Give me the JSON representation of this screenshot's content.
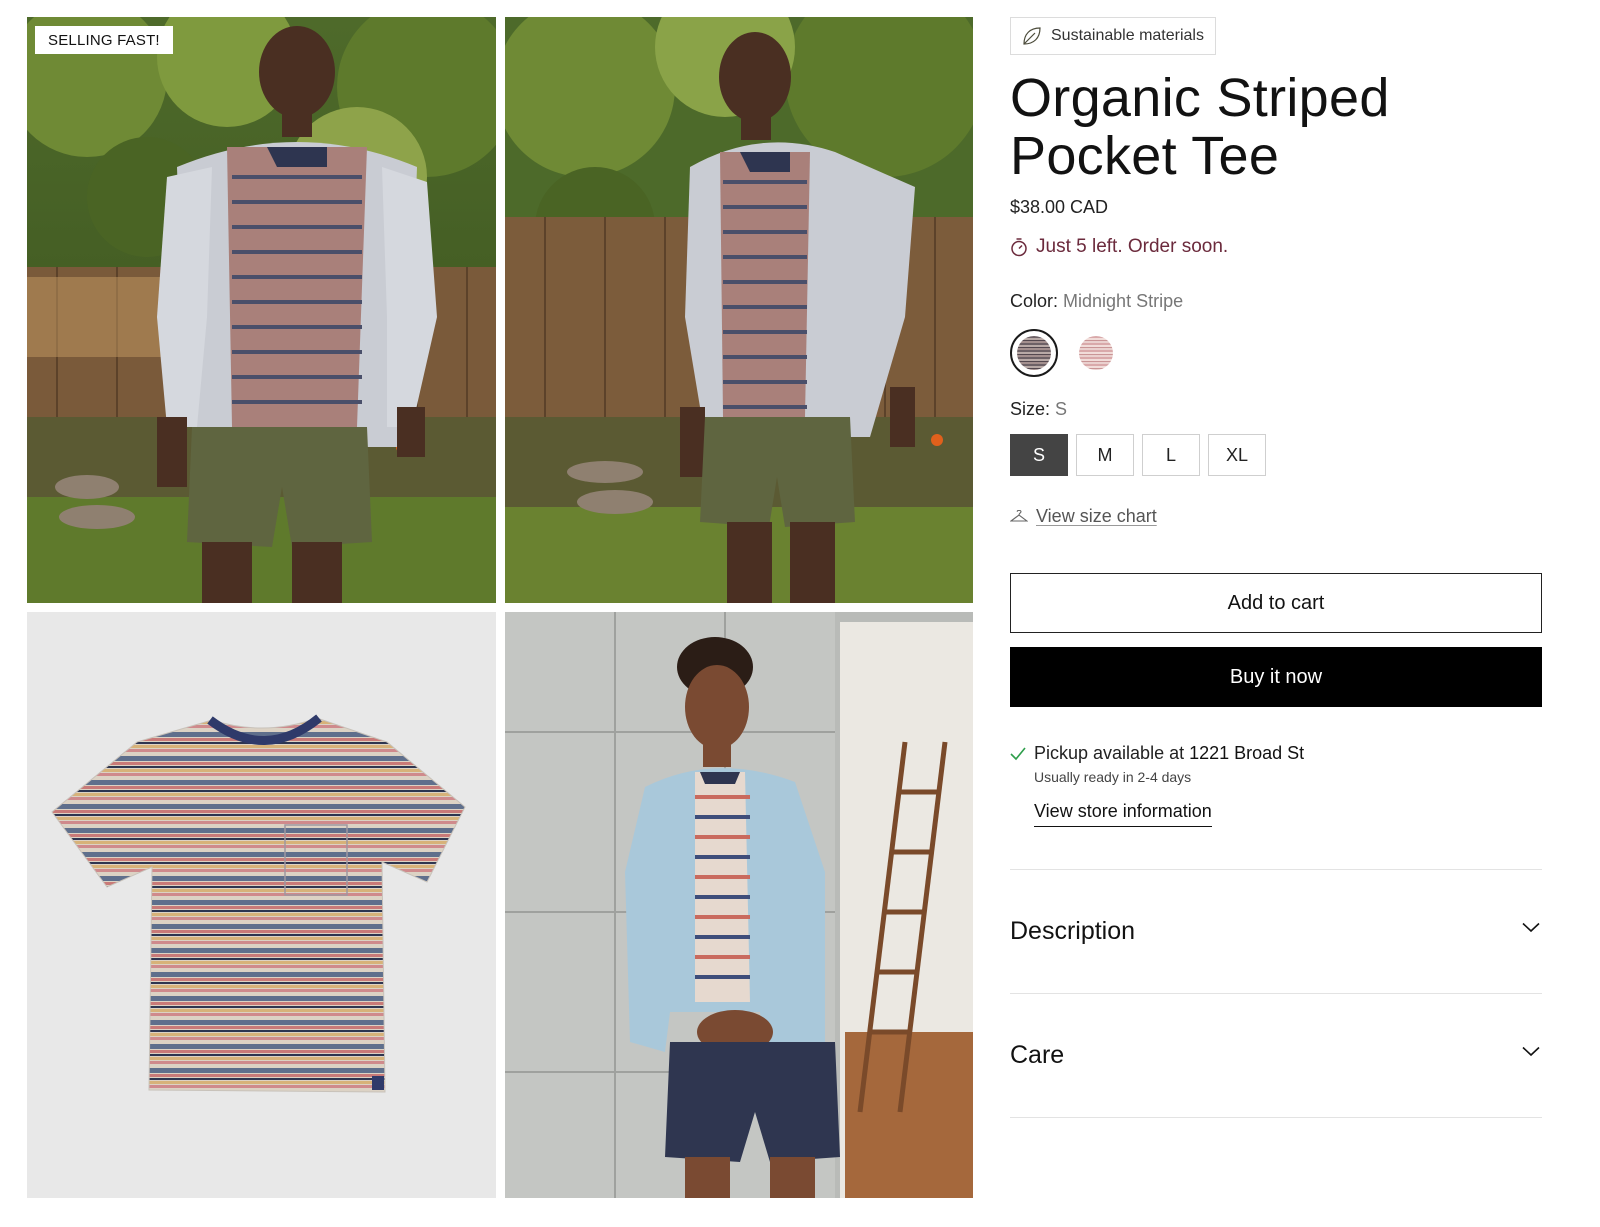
{
  "gallery": {
    "badge": "SELLING FAST!",
    "images": [
      {
        "alt": "Model in garden wearing open chambray shirt over striped tee and olive shorts"
      },
      {
        "alt": "Model in garden, alternate pose"
      },
      {
        "alt": "Flat-lay of striped pocket tee"
      },
      {
        "alt": "Model in studio wearing light blue shirt, striped tee and navy shorts"
      }
    ]
  },
  "product": {
    "tag": {
      "icon": "leaf-icon",
      "label": "Sustainable materials"
    },
    "title": "Organic Striped Pocket Tee",
    "price": "$38.00 CAD",
    "stock_notice": {
      "icon": "stopwatch-icon",
      "text": "Just 5 left. Order soon.",
      "color": "#6b2a3c"
    },
    "color": {
      "label": "Color:",
      "selected": "Midnight Stripe",
      "options": [
        {
          "name": "Midnight Stripe",
          "selected": true
        },
        {
          "name": "Rose Stripe",
          "selected": false
        }
      ]
    },
    "size": {
      "label": "Size:",
      "selected": "S",
      "options": [
        "S",
        "M",
        "L",
        "XL"
      ]
    },
    "size_chart_link": {
      "icon": "hanger-icon",
      "label": "View size chart"
    },
    "add_to_cart": "Add to cart",
    "buy_now": "Buy it now",
    "pickup": {
      "icon": "check-icon",
      "prefix": "Pickup available at ",
      "location": "1221 Broad St",
      "sub": "Usually ready in 2-4 days",
      "store_link": "View store information"
    },
    "accordions": [
      {
        "title": "Description",
        "icon": "chevron-down-icon"
      },
      {
        "title": "Care",
        "icon": "chevron-down-icon"
      }
    ]
  },
  "colors": {
    "primary_button": "#000000",
    "selected_size": "#444444",
    "pickup_check": "#2e9e4b"
  }
}
